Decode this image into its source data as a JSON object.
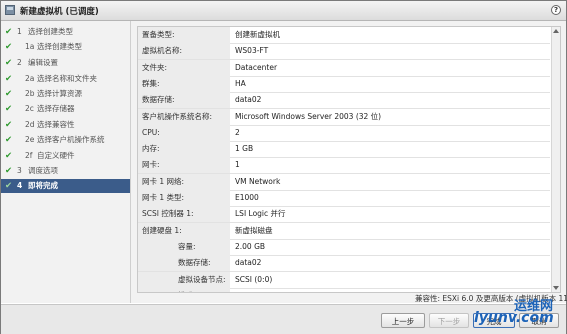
{
  "window": {
    "title": "新建虚拟机 (已调度)",
    "help_icon": "?"
  },
  "sidebar": {
    "steps": [
      {
        "num": "1",
        "label": "选择创建类型",
        "done": true,
        "active": false
      },
      {
        "num": "1a",
        "label": "选择创建类型",
        "done": true,
        "active": false
      },
      {
        "num": "2",
        "label": "编辑设置",
        "done": true,
        "active": false
      },
      {
        "num": "2a",
        "label": "选择名称和文件夹",
        "done": true,
        "active": false
      },
      {
        "num": "2b",
        "label": "选择计算资源",
        "done": true,
        "active": false
      },
      {
        "num": "2c",
        "label": "选择存储器",
        "done": true,
        "active": false
      },
      {
        "num": "2d",
        "label": "选择兼容性",
        "done": true,
        "active": false
      },
      {
        "num": "2e",
        "label": "选择客户机操作系统",
        "done": true,
        "active": false
      },
      {
        "num": "2f",
        "label": "自定义硬件",
        "done": true,
        "active": false
      },
      {
        "num": "3",
        "label": "调度选项",
        "done": true,
        "active": false
      },
      {
        "num": "4",
        "label": "即将完成",
        "done": true,
        "active": true
      }
    ]
  },
  "summary": {
    "rows": [
      {
        "key": "置备类型:",
        "value": "创建新虚拟机",
        "sub": false
      },
      {
        "key": "虚拟机名称:",
        "value": "WS03-FT",
        "sub": false
      },
      {
        "key": "文件夹:",
        "value": "Datacenter",
        "sub": false
      },
      {
        "key": "群集:",
        "value": "HA",
        "sub": false
      },
      {
        "key": "数据存储:",
        "value": "data02",
        "sub": false
      },
      {
        "key": "客户机操作系统名称:",
        "value": "Microsoft Windows Server 2003 (32 位)",
        "sub": false
      },
      {
        "key": "CPU:",
        "value": "2",
        "sub": false
      },
      {
        "key": "内存:",
        "value": "1 GB",
        "sub": false
      },
      {
        "key": "网卡:",
        "value": "1",
        "sub": false
      },
      {
        "key": "网卡 1 网络:",
        "value": "VM Network",
        "sub": false
      },
      {
        "key": "网卡 1 类型:",
        "value": "E1000",
        "sub": false
      },
      {
        "key": "SCSI 控制器 1:",
        "value": "LSI Logic 并行",
        "sub": false
      },
      {
        "key": "创建硬盘 1:",
        "value": "新虚拟磁盘",
        "sub": false
      },
      {
        "key": "容量:",
        "value": "2.00 GB",
        "sub": true
      },
      {
        "key": "数据存储:",
        "value": "data02",
        "sub": true
      },
      {
        "key": "虚拟设备节点:",
        "value": "SCSI (0:0)",
        "sub": true
      },
      {
        "key": "模式:",
        "value": "从属",
        "sub": true
      }
    ],
    "compatibility": "兼容性: ESXi 6.0 及更高版本 (虚拟机版本 11)"
  },
  "footer": {
    "back_label": "上一步",
    "next_label": "下一步",
    "finish_label": "完成",
    "cancel_label": "取消"
  },
  "watermark": {
    "brand": "运维网",
    "url": "iyunv.com"
  }
}
